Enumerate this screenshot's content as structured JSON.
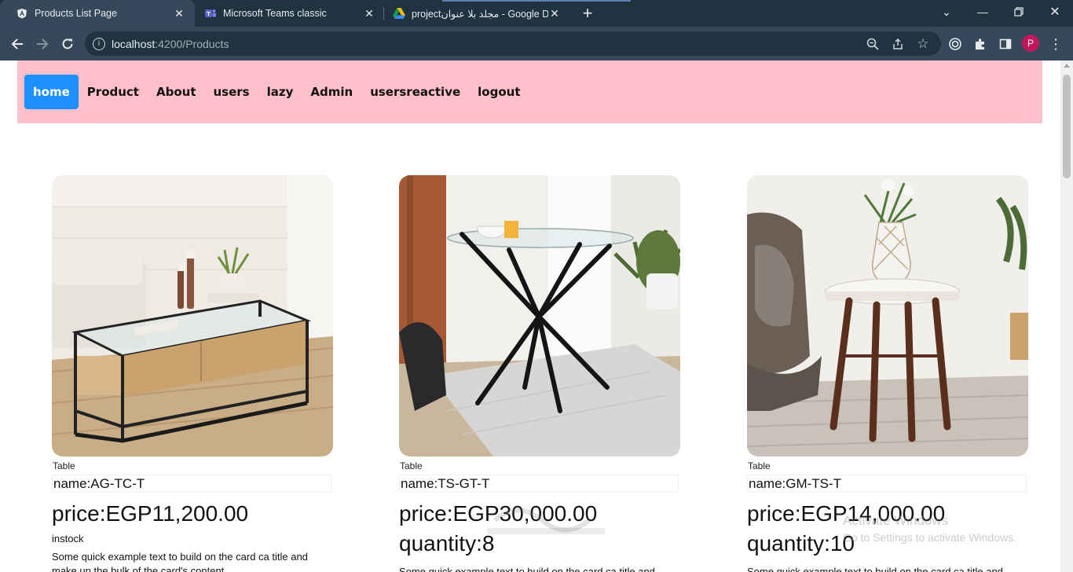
{
  "browser": {
    "tabs": [
      {
        "title": "Products List Page",
        "active": true
      },
      {
        "title": "Microsoft Teams classic",
        "active": false
      },
      {
        "title": "projectمجلد بلا عنوان - Google Dr",
        "active": false
      }
    ],
    "url_host": "localhost",
    "url_path": ":4200/Products",
    "profile_initial": "P"
  },
  "nav": {
    "links": [
      "home",
      "Product",
      "About",
      "users",
      "lazy",
      "Admin",
      "usersreactive",
      "logout"
    ]
  },
  "products": [
    {
      "category": "Table",
      "name": "name:AG-TC-T",
      "price": "price:EGP11,200.00",
      "quantity": "",
      "stock": "instock",
      "description": "Some quick example text to build on the card ca title and make up the bulk of the card's content."
    },
    {
      "category": "Table",
      "name": "name:TS-GT-T",
      "price": "price:EGP30,000.00",
      "quantity": "quantity:8",
      "stock": "",
      "description": "Some quick example text to build on the card ca title and"
    },
    {
      "category": "Table",
      "name": "name:GM-TS-T",
      "price": "price:EGP14,000.00",
      "quantity": "quantity:10",
      "stock": "",
      "description": "Some quick example text to build on the card ca title and"
    }
  ],
  "activation": {
    "title": "Activate Windows",
    "subtitle": "Go to Settings to activate Windows."
  }
}
